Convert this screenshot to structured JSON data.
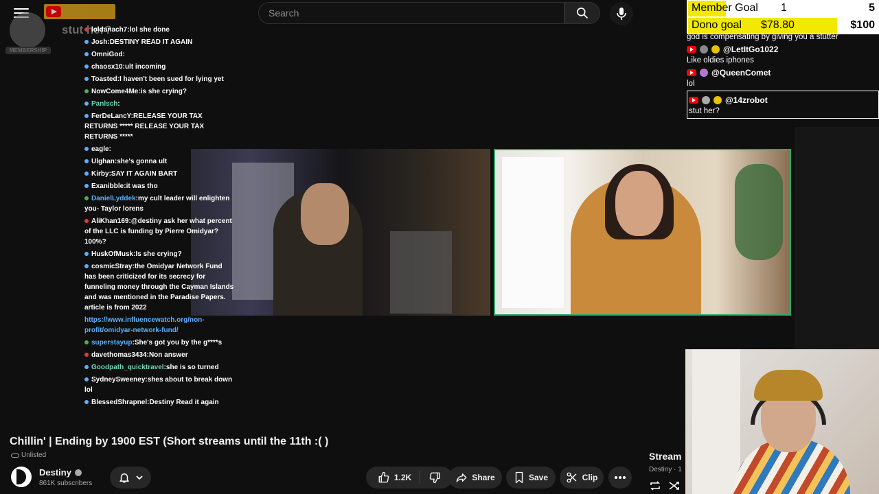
{
  "topbar": {
    "search_placeholder": "Search",
    "membership_label": "MEMBERSHIP",
    "ghost_text": "stut her?"
  },
  "left_chat": [
    {
      "name": "loldanach7",
      "text": "lol she done",
      "color": "red"
    },
    {
      "name": "Josh",
      "text": "DESTINY READ IT AGAIN",
      "color": "blue"
    },
    {
      "name": "OmniGod",
      "text": "",
      "color": "blue"
    },
    {
      "name": "chaosx10",
      "text": "ult incoming",
      "color": "blue"
    },
    {
      "name": "Toasted",
      "text": "I haven't been sued for lying yet",
      "color": "blue"
    },
    {
      "name": "NowCome4Me",
      "text": "is she crying?",
      "color": "green"
    },
    {
      "name": "Panlsch",
      "text": "",
      "color": "blue",
      "name_style": "green"
    },
    {
      "name": "FerDeLancY",
      "text": "RELEASE YOUR TAX RETURNS ***** RELEASE YOUR TAX RETURNS *****",
      "color": "blue"
    },
    {
      "name": "eagle",
      "text": "",
      "color": "blue"
    },
    {
      "name": "Ulghan",
      "text": "she's gonna ult",
      "color": "blue"
    },
    {
      "name": "Kirby",
      "text": "SAY IT AGAIN BART",
      "color": "blue"
    },
    {
      "name": "Exanibble",
      "text": "it was tho",
      "color": "blue"
    },
    {
      "name": "DanielLyddek",
      "text": "my cult leader will enlighten you- Taylor lorens",
      "color": "green",
      "name_style": "blue"
    },
    {
      "name": "AliKhan169",
      "text": "@destiny ask her what percent of the LLC is funding by Pierre Omidyar? 100%?",
      "color": "red"
    },
    {
      "name": "HuskOfMusk",
      "text": "Is she crying?",
      "color": "blue"
    },
    {
      "name": "cosmicStray",
      "text": "the Omidyar Network Fund has been criticized for its secrecy for funneling money through the Cayman Islands and was mentioned in the Paradise Papers. article is from 2022",
      "color": "blue"
    },
    {
      "name": "",
      "text": "",
      "link": "https://www.influencewatch.org/non-profit/omidyar-network-fund/",
      "color": ""
    },
    {
      "name": "superstayup",
      "text": "She's got you by the g****s",
      "color": "green",
      "name_style": "blue"
    },
    {
      "name": "davethomas3434",
      "text": "Non answer",
      "color": "red"
    },
    {
      "name": "Goodpath_quicktravel",
      "text": "she is so turned",
      "color": "blue",
      "name_style": "green"
    },
    {
      "name": "SydneySweeney",
      "text": "shes about to break down lol",
      "color": "blue"
    },
    {
      "name": "BlessedShrapnel",
      "text": "Destiny Read it again",
      "color": "blue"
    }
  ],
  "goals": {
    "member": {
      "label": "Member Goal",
      "current": "1",
      "max": "5",
      "progress": 0.2
    },
    "dono": {
      "label": "Dono goal",
      "current": "$78.80",
      "max": "$100",
      "progress": 0.788
    }
  },
  "right_chat": {
    "first_text": "god is compensating by giving you a stutter",
    "messages": [
      {
        "user": "@LetItGo1022",
        "text": "Like oldies iphones"
      },
      {
        "user": "@QueenComet",
        "text": "lol"
      },
      {
        "user": "@14zrobot",
        "text": "stut her?"
      }
    ]
  },
  "video": {
    "title": "Chillin' | Ending by 1900 EST (Short streams until the 11th :( )",
    "visibility": "Unlisted",
    "channel": "Destiny",
    "subscribers": "861K subscribers",
    "likes": "1.2K",
    "share_label": "Share",
    "save_label": "Save",
    "clip_label": "Clip"
  },
  "sidebar_card": {
    "title": "Stream",
    "channel": "Destiny · 1"
  },
  "colors": {
    "accent_red": "#ff0000",
    "goal_yellow": "#f3e800",
    "frame_green": "#2fa86a",
    "link_blue": "#5ab0ff"
  }
}
